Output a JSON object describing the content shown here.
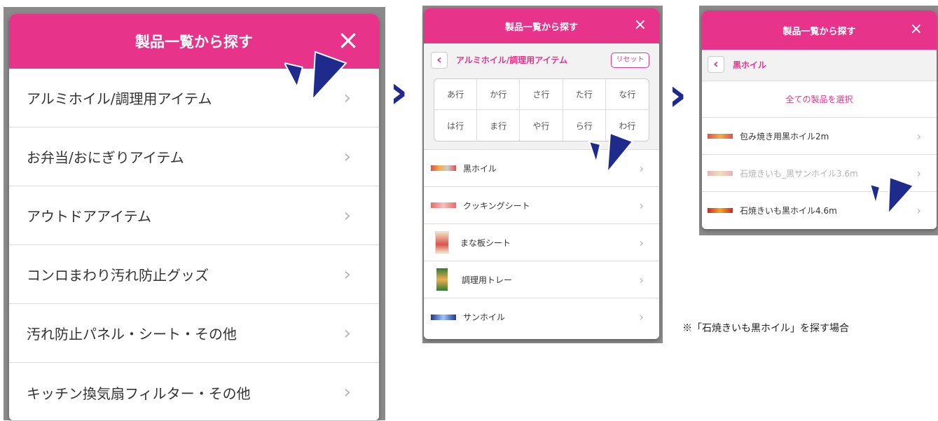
{
  "colors": {
    "accent": "#e8338a",
    "pointer": "#1e2a8c",
    "divider": "#dcdcdc",
    "chevron": "#b5b5b5",
    "disabled_text": "#b4b4b4"
  },
  "panel1": {
    "title": "製品一覧から探す",
    "close_icon": "×",
    "items": [
      {
        "label": "アルミホイル/調理用アイテム"
      },
      {
        "label": "お弁当/おにぎりアイテム"
      },
      {
        "label": "アウトドアアイテム"
      },
      {
        "label": "コンロまわり汚れ防止グッズ"
      },
      {
        "label": "汚れ防止パネル・シート・その他"
      },
      {
        "label": "キッチン換気扇フィルター・その他"
      }
    ],
    "chevron": "›"
  },
  "arrow_icon": "›",
  "panel2": {
    "title": "製品一覧から探す",
    "close_icon": "×",
    "back_icon": "‹",
    "category": "アルミホイル/調理用アイテム",
    "reset_label": "リセット",
    "kana_rows": [
      [
        "あ行",
        "か行",
        "さ行",
        "た行",
        "な行"
      ],
      [
        "は行",
        "ま行",
        "や行",
        "ら行",
        "わ行"
      ]
    ],
    "products": [
      {
        "label": "黒ホイル"
      },
      {
        "label": "クッキングシート"
      },
      {
        "label": "まな板シート"
      },
      {
        "label": "調理用トレー"
      },
      {
        "label": "サンホイル"
      }
    ],
    "chevron": "›"
  },
  "panel3": {
    "title": "製品一覧から探す",
    "close_icon": "×",
    "back_icon": "‹",
    "category": "黒ホイル",
    "select_all": "全ての製品を選択",
    "products": [
      {
        "label": "包み焼き用黒ホイル2m",
        "disabled": false
      },
      {
        "label": "石焼きいも_黒サンホイル3.6m",
        "disabled": true
      },
      {
        "label": "石焼きいも黒ホイル4.6m",
        "disabled": false
      }
    ],
    "chevron": "›"
  },
  "note": "※「石焼きいも黒ホイル」を探す場合"
}
